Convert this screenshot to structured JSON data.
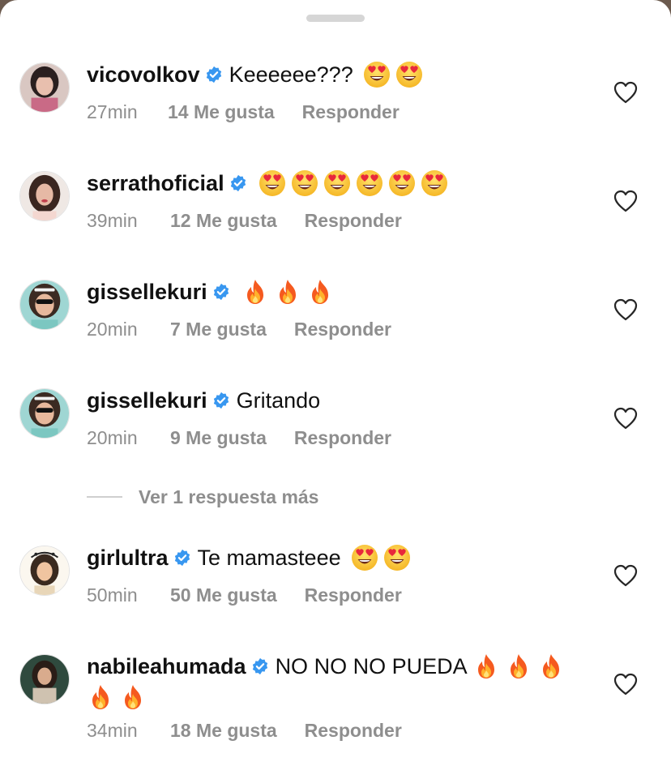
{
  "view_more": "Ver 1 respuesta más",
  "colors": {
    "verified": "#3897f0",
    "meta_text": "#8e8e8e",
    "text": "#111111"
  },
  "comments": [
    {
      "username": "vicovolkov",
      "verified": true,
      "text": "Keeeeee???",
      "emoji": [
        "heart-eyes",
        "heart-eyes"
      ],
      "time": "27min",
      "likes": "14 Me gusta",
      "reply": "Responder"
    },
    {
      "username": "serrathoficial",
      "verified": true,
      "text": "",
      "emoji": [
        "heart-eyes",
        "heart-eyes",
        "heart-eyes",
        "heart-eyes",
        "heart-eyes",
        "heart-eyes"
      ],
      "time": "39min",
      "likes": "12 Me gusta",
      "reply": "Responder"
    },
    {
      "username": "gissellekuri",
      "verified": true,
      "text": "",
      "emoji": [
        "fire",
        "fire",
        "fire"
      ],
      "time": "20min",
      "likes": "7 Me gusta",
      "reply": "Responder"
    },
    {
      "username": "gissellekuri",
      "verified": true,
      "text": "Gritando",
      "emoji": [],
      "time": "20min",
      "likes": "9 Me gusta",
      "reply": "Responder"
    },
    {
      "username": "girlultra",
      "verified": true,
      "text": "Te mamasteee",
      "emoji": [
        "heart-eyes",
        "heart-eyes"
      ],
      "time": "50min",
      "likes": "50 Me gusta",
      "reply": "Responder"
    },
    {
      "username": "nabileahumada",
      "verified": true,
      "text": "NO NO NO PUEDA",
      "emoji": [
        "fire",
        "fire",
        "fire"
      ],
      "emoji_line2": [
        "fire",
        "fire"
      ],
      "time": "34min",
      "likes": "18 Me gusta",
      "reply": "Responder"
    }
  ]
}
